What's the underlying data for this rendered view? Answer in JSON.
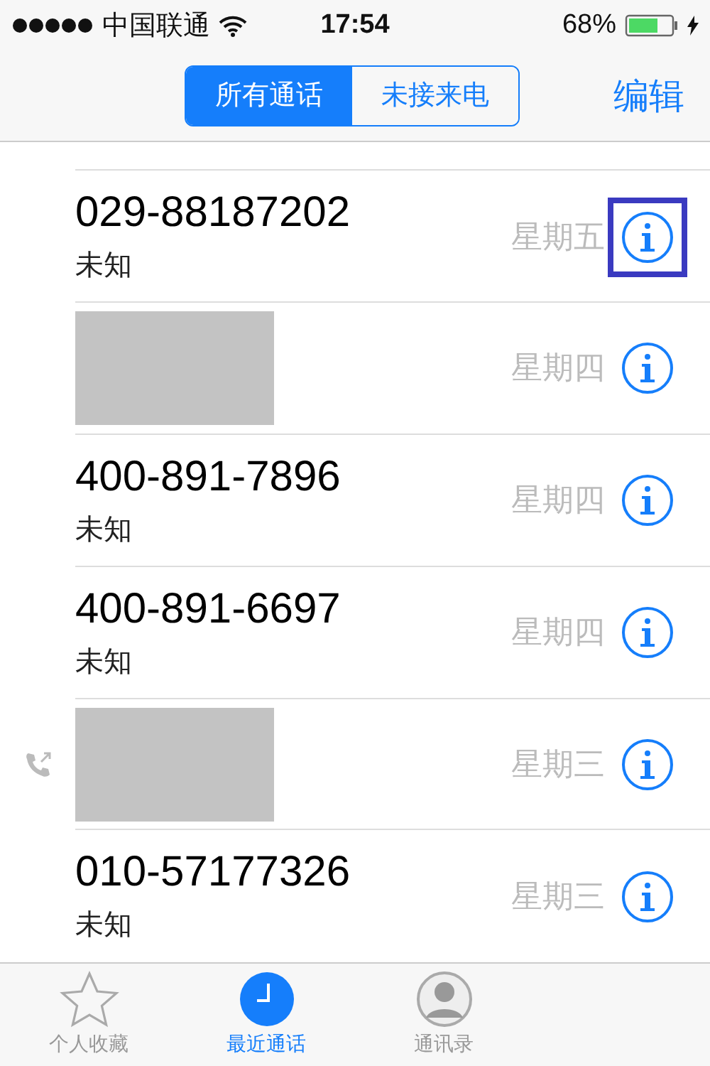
{
  "status_bar": {
    "carrier": "中国联通",
    "time": "17:54",
    "battery_text": "68%",
    "charging": true
  },
  "nav": {
    "segments": [
      {
        "label": "所有通话",
        "selected": true
      },
      {
        "label": "未接来电",
        "selected": false
      }
    ],
    "edit": "编辑"
  },
  "calls": [
    {
      "kind": "number",
      "number": "029-88187202",
      "label": "未知",
      "day": "星期五",
      "outgoing": false,
      "highlighted": true
    },
    {
      "kind": "redacted",
      "day": "星期四",
      "outgoing": false,
      "highlighted": false
    },
    {
      "kind": "number",
      "number": "400-891-7896",
      "label": "未知",
      "day": "星期四",
      "outgoing": false,
      "highlighted": false
    },
    {
      "kind": "number",
      "number": "400-891-6697",
      "label": "未知",
      "day": "星期四",
      "outgoing": false,
      "highlighted": false
    },
    {
      "kind": "redacted",
      "day": "星期三",
      "outgoing": true,
      "highlighted": false
    },
    {
      "kind": "number",
      "number": "010-57177326",
      "label": "未知",
      "day": "星期三",
      "outgoing": false,
      "highlighted": false
    }
  ],
  "tab_bar": [
    {
      "label": "个人收藏",
      "kind": "star",
      "selected": false
    },
    {
      "label": "最近通话",
      "kind": "clock",
      "selected": true
    },
    {
      "label": "通讯录",
      "kind": "contact",
      "selected": false
    }
  ]
}
